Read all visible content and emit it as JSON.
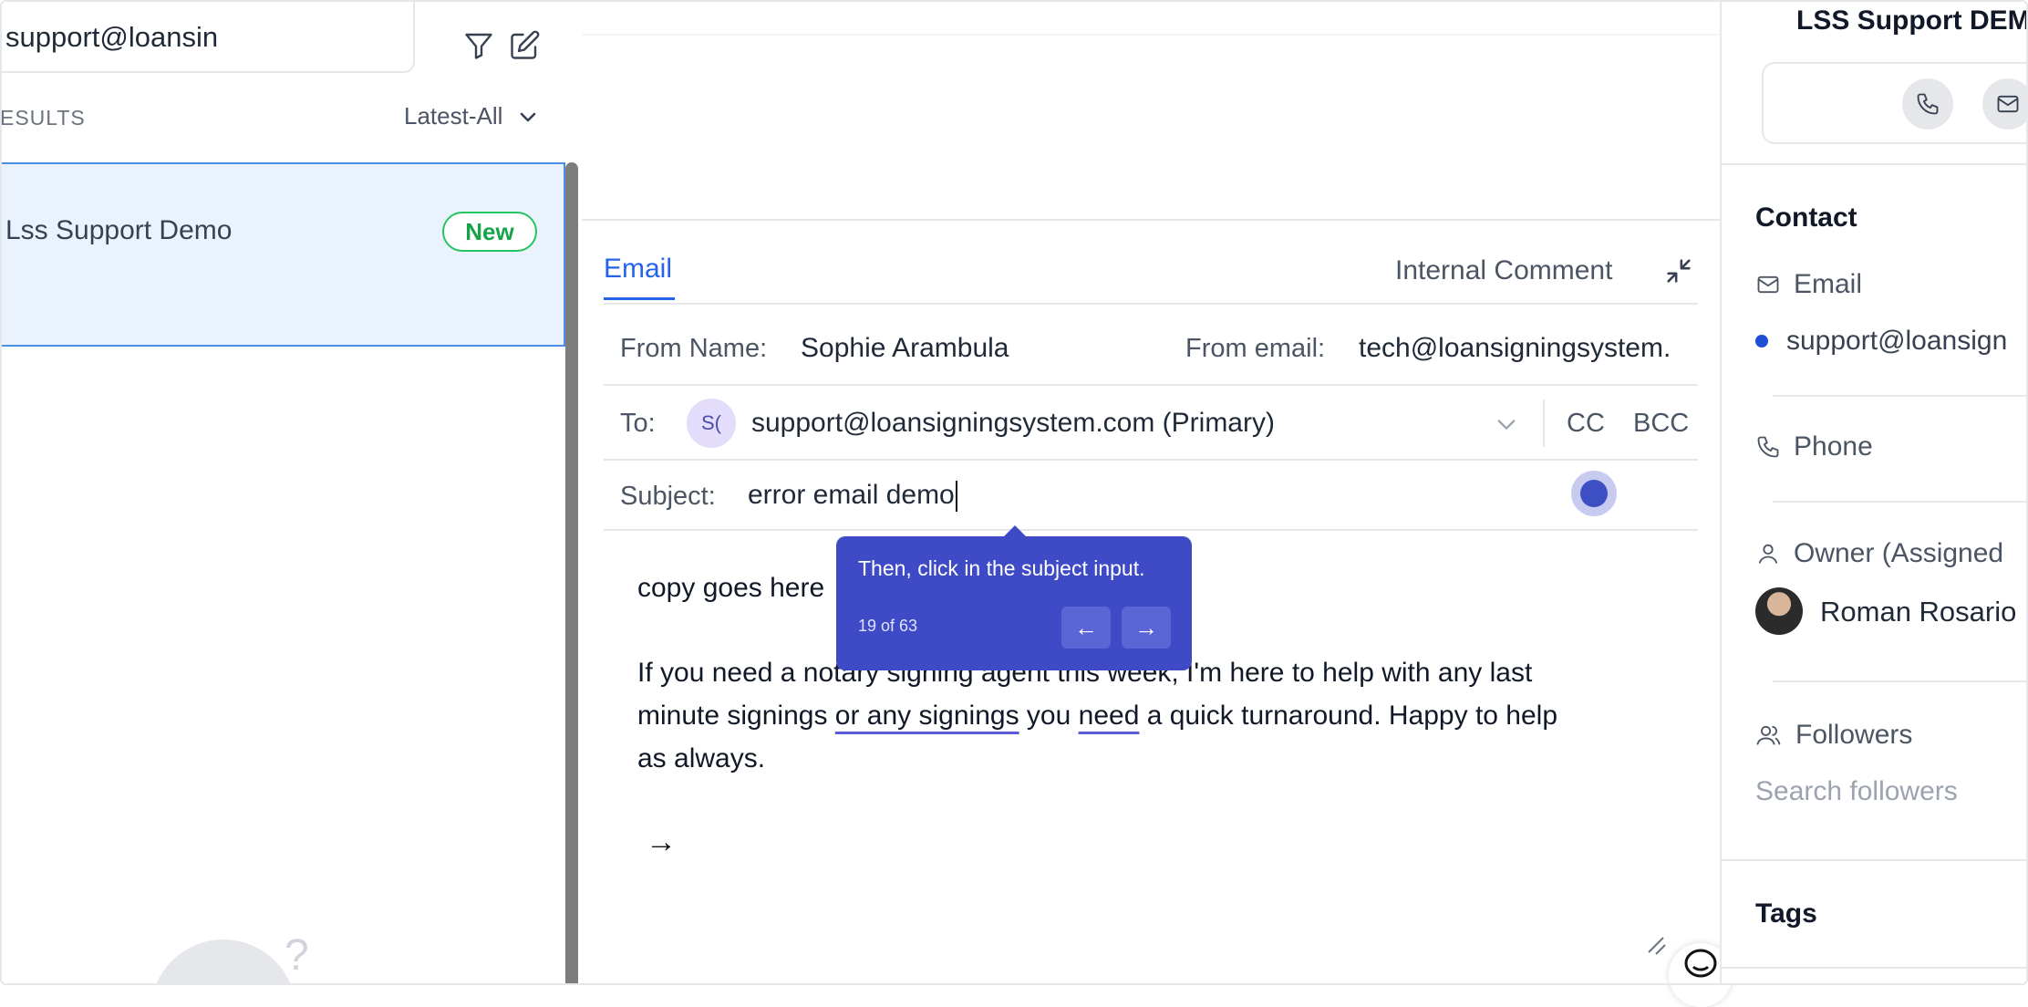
{
  "left": {
    "search_value": "support@loansin",
    "results_label": "ESULTS",
    "sort_label": "Latest-All",
    "conversation": {
      "name": "Lss Support Demo",
      "badge": "New"
    },
    "help_mark": "?"
  },
  "composer": {
    "tabs": {
      "email": "Email",
      "internal": "Internal Comment"
    },
    "from_name_label": "From Name:",
    "from_name_value": "Sophie Arambula",
    "from_email_label": "From email:",
    "from_email_value": "tech@loansigningsystem.",
    "to_label": "To:",
    "to_avatar": "S(",
    "to_value": "support@loansigningsystem.com (Primary)",
    "cc": "CC",
    "bcc": "BCC",
    "subject_label": "Subject:",
    "subject_value": "error email demo",
    "body": {
      "line1": "copy goes here",
      "p1": "If you need a notary signing agent this week, I'm here to help with any last",
      "p2_a": "minute signings ",
      "p2_u1": "or any signings",
      "p2_b": " you ",
      "p2_u2": "need",
      "p2_c": " a quick turnaround. Happy to help",
      "p3": "as always.",
      "send_arrow": "→"
    }
  },
  "tooltip": {
    "text": "Then, click in the subject input.",
    "count": "19 of 63",
    "prev": "←",
    "next": "→"
  },
  "right": {
    "title": "LSS Support DEM",
    "contact_heading": "Contact",
    "email_label": "Email",
    "email_value": "support@loansign",
    "phone_label": "Phone",
    "owner_label": "Owner (Assigned",
    "owner_name": "Roman Rosario",
    "followers_label": "Followers",
    "followers_placeholder": "Search followers",
    "tags_heading": "Tags"
  },
  "colors": {
    "accent": "#2563eb",
    "tooltip": "#3f4ac6",
    "selected_card": "#eaf3fd",
    "badge_green": "#16a34a"
  }
}
